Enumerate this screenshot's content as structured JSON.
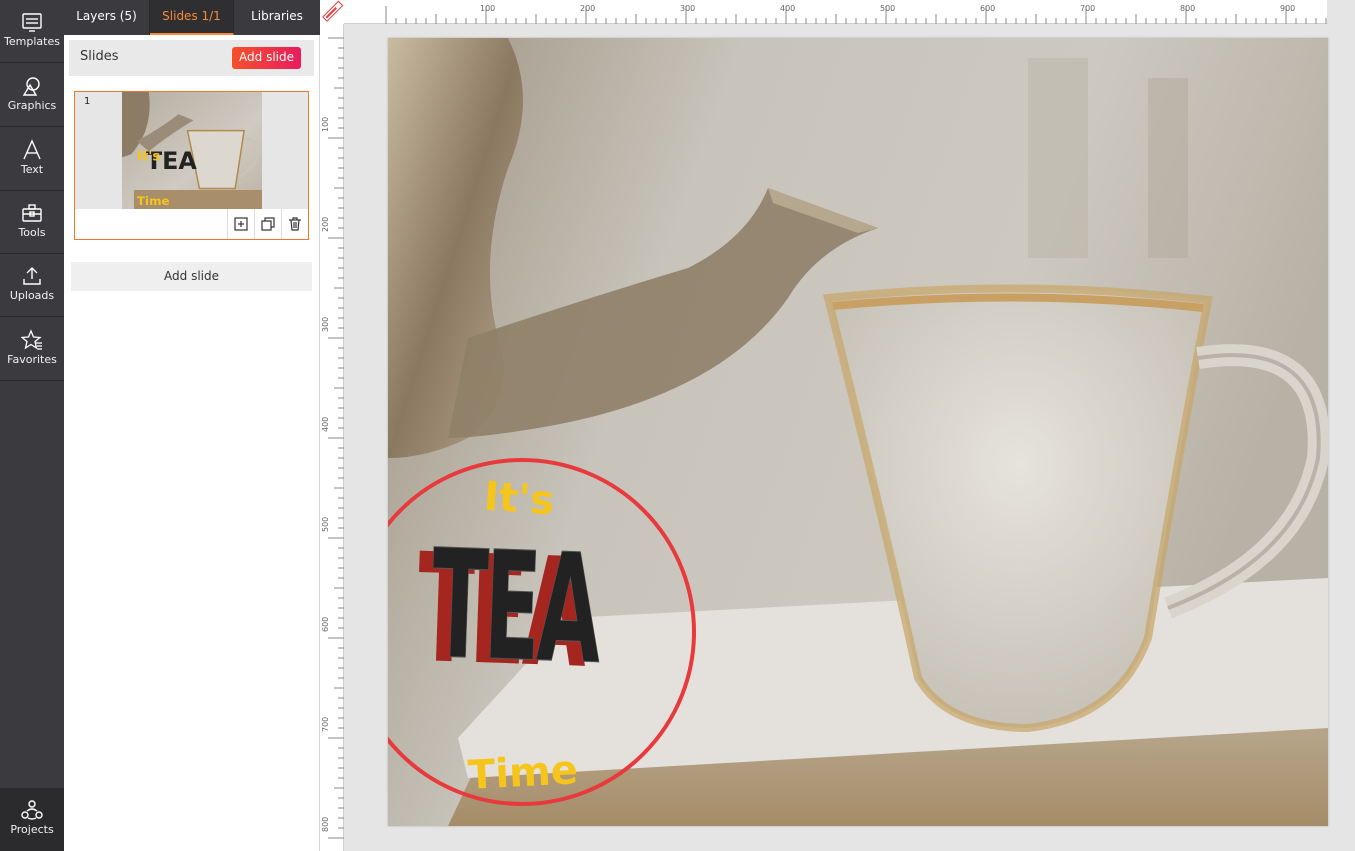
{
  "rail": {
    "items": [
      {
        "label": "Templates",
        "icon": "templates-icon"
      },
      {
        "label": "Graphics",
        "icon": "graphics-icon"
      },
      {
        "label": "Text",
        "icon": "text-icon"
      },
      {
        "label": "Tools",
        "icon": "tools-icon"
      },
      {
        "label": "Uploads",
        "icon": "uploads-icon"
      },
      {
        "label": "Favorites",
        "icon": "favorites-icon"
      }
    ],
    "projects_label": "Projects"
  },
  "tabs": [
    {
      "label": "Layers (5)"
    },
    {
      "label": "Slides 1/1",
      "active": true
    },
    {
      "label": "Libraries"
    }
  ],
  "slides_panel": {
    "title": "Slides",
    "add_button": "Add slide",
    "add_button_bottom": "Add slide",
    "slides": [
      {
        "number": "1"
      }
    ]
  },
  "ruler": {
    "top": [
      "100",
      "200",
      "300",
      "400",
      "500",
      "600",
      "700",
      "800",
      "900"
    ],
    "left": [
      "100",
      "200",
      "300",
      "400",
      "500",
      "600",
      "700",
      "800"
    ]
  },
  "design": {
    "line1": "It's",
    "line2": "TEA",
    "line3": "Time"
  },
  "colors": {
    "accent": "#f7893b",
    "add_button_gradient_start": "#f5512a",
    "add_button_gradient_end": "#e81c5e",
    "circle_stroke": "#e8393c",
    "yellow_text": "#f6c51b",
    "tea_shadow": "#a5251f",
    "tea_fill": "#222222"
  }
}
